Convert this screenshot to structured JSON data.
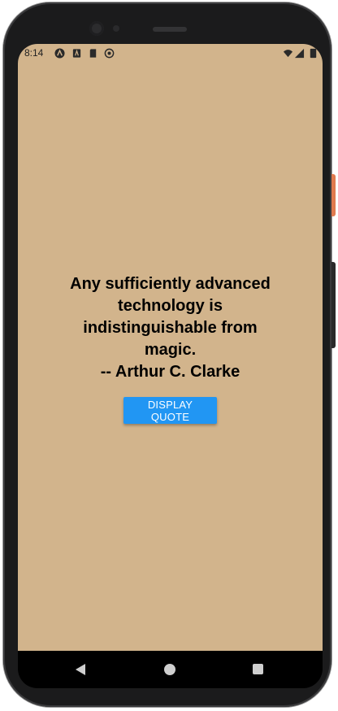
{
  "status_bar": {
    "time": "8:14",
    "left_icons": [
      "react-native-icon",
      "debug-icon",
      "sd-card-icon",
      "sync-icon"
    ],
    "right_icons": [
      "wifi-icon",
      "signal-icon",
      "battery-icon"
    ]
  },
  "quote": {
    "text": "Any sufficiently advanced technology is indistinguishable from magic.",
    "author": "-- Arthur C. Clarke"
  },
  "button": {
    "label": "DISPLAY QUOTE"
  },
  "colors": {
    "background": "#d2b48c",
    "button": "#2196f3",
    "button_text": "#ffffff",
    "text": "#000000"
  },
  "nav_bar": {
    "icons": [
      "back-icon",
      "home-icon",
      "recents-icon"
    ]
  }
}
